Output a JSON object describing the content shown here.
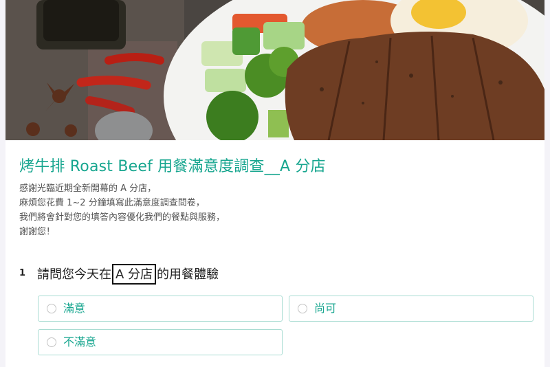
{
  "form": {
    "title": "烤牛排 Roast Beef 用餐滿意度調查__A 分店",
    "description": [
      "感謝光臨近期全新開幕的 A 分店，",
      "麻煩您花費 1~2 分鐘填寫此滿意度調查問卷，",
      "我們將會針對您的填答內容優化我們的餐點與服務，",
      "謝謝您！"
    ]
  },
  "question": {
    "number": "1",
    "text_before": "請問您今天在",
    "text_highlight": "A 分店",
    "text_after": "的用餐體驗",
    "options": [
      "滿意",
      "尚可",
      "不滿意"
    ]
  },
  "colors": {
    "accent": "#17a68f",
    "option_border": "#a8dcd2",
    "page_background": "#f4f3f8"
  }
}
